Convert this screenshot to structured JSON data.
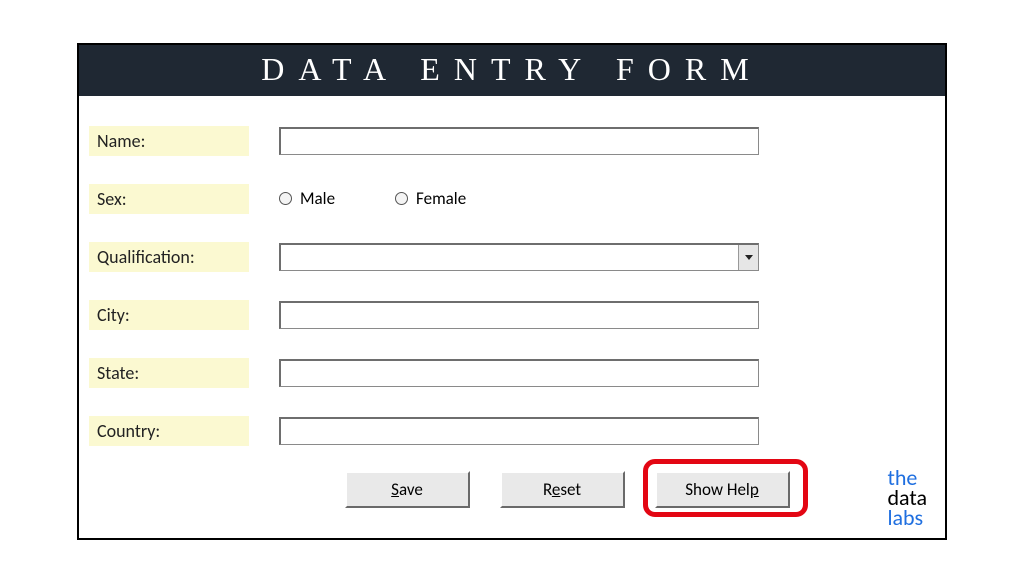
{
  "title": "DATA ENTRY FORM",
  "fields": {
    "name_label": "Name:",
    "name_value": "",
    "sex_label": "Sex:",
    "sex_male": "Male",
    "sex_female": "Female",
    "qualification_label": "Qualification:",
    "qualification_value": "",
    "city_label": "City:",
    "city_value": "",
    "state_label": "State:",
    "state_value": "",
    "country_label": "Country:",
    "country_value": ""
  },
  "buttons": {
    "save": "Save",
    "reset": "Reset",
    "show_help": "Show Help"
  },
  "logo": {
    "line1a": "the",
    "line2a": "data",
    "line3a": "labs"
  }
}
